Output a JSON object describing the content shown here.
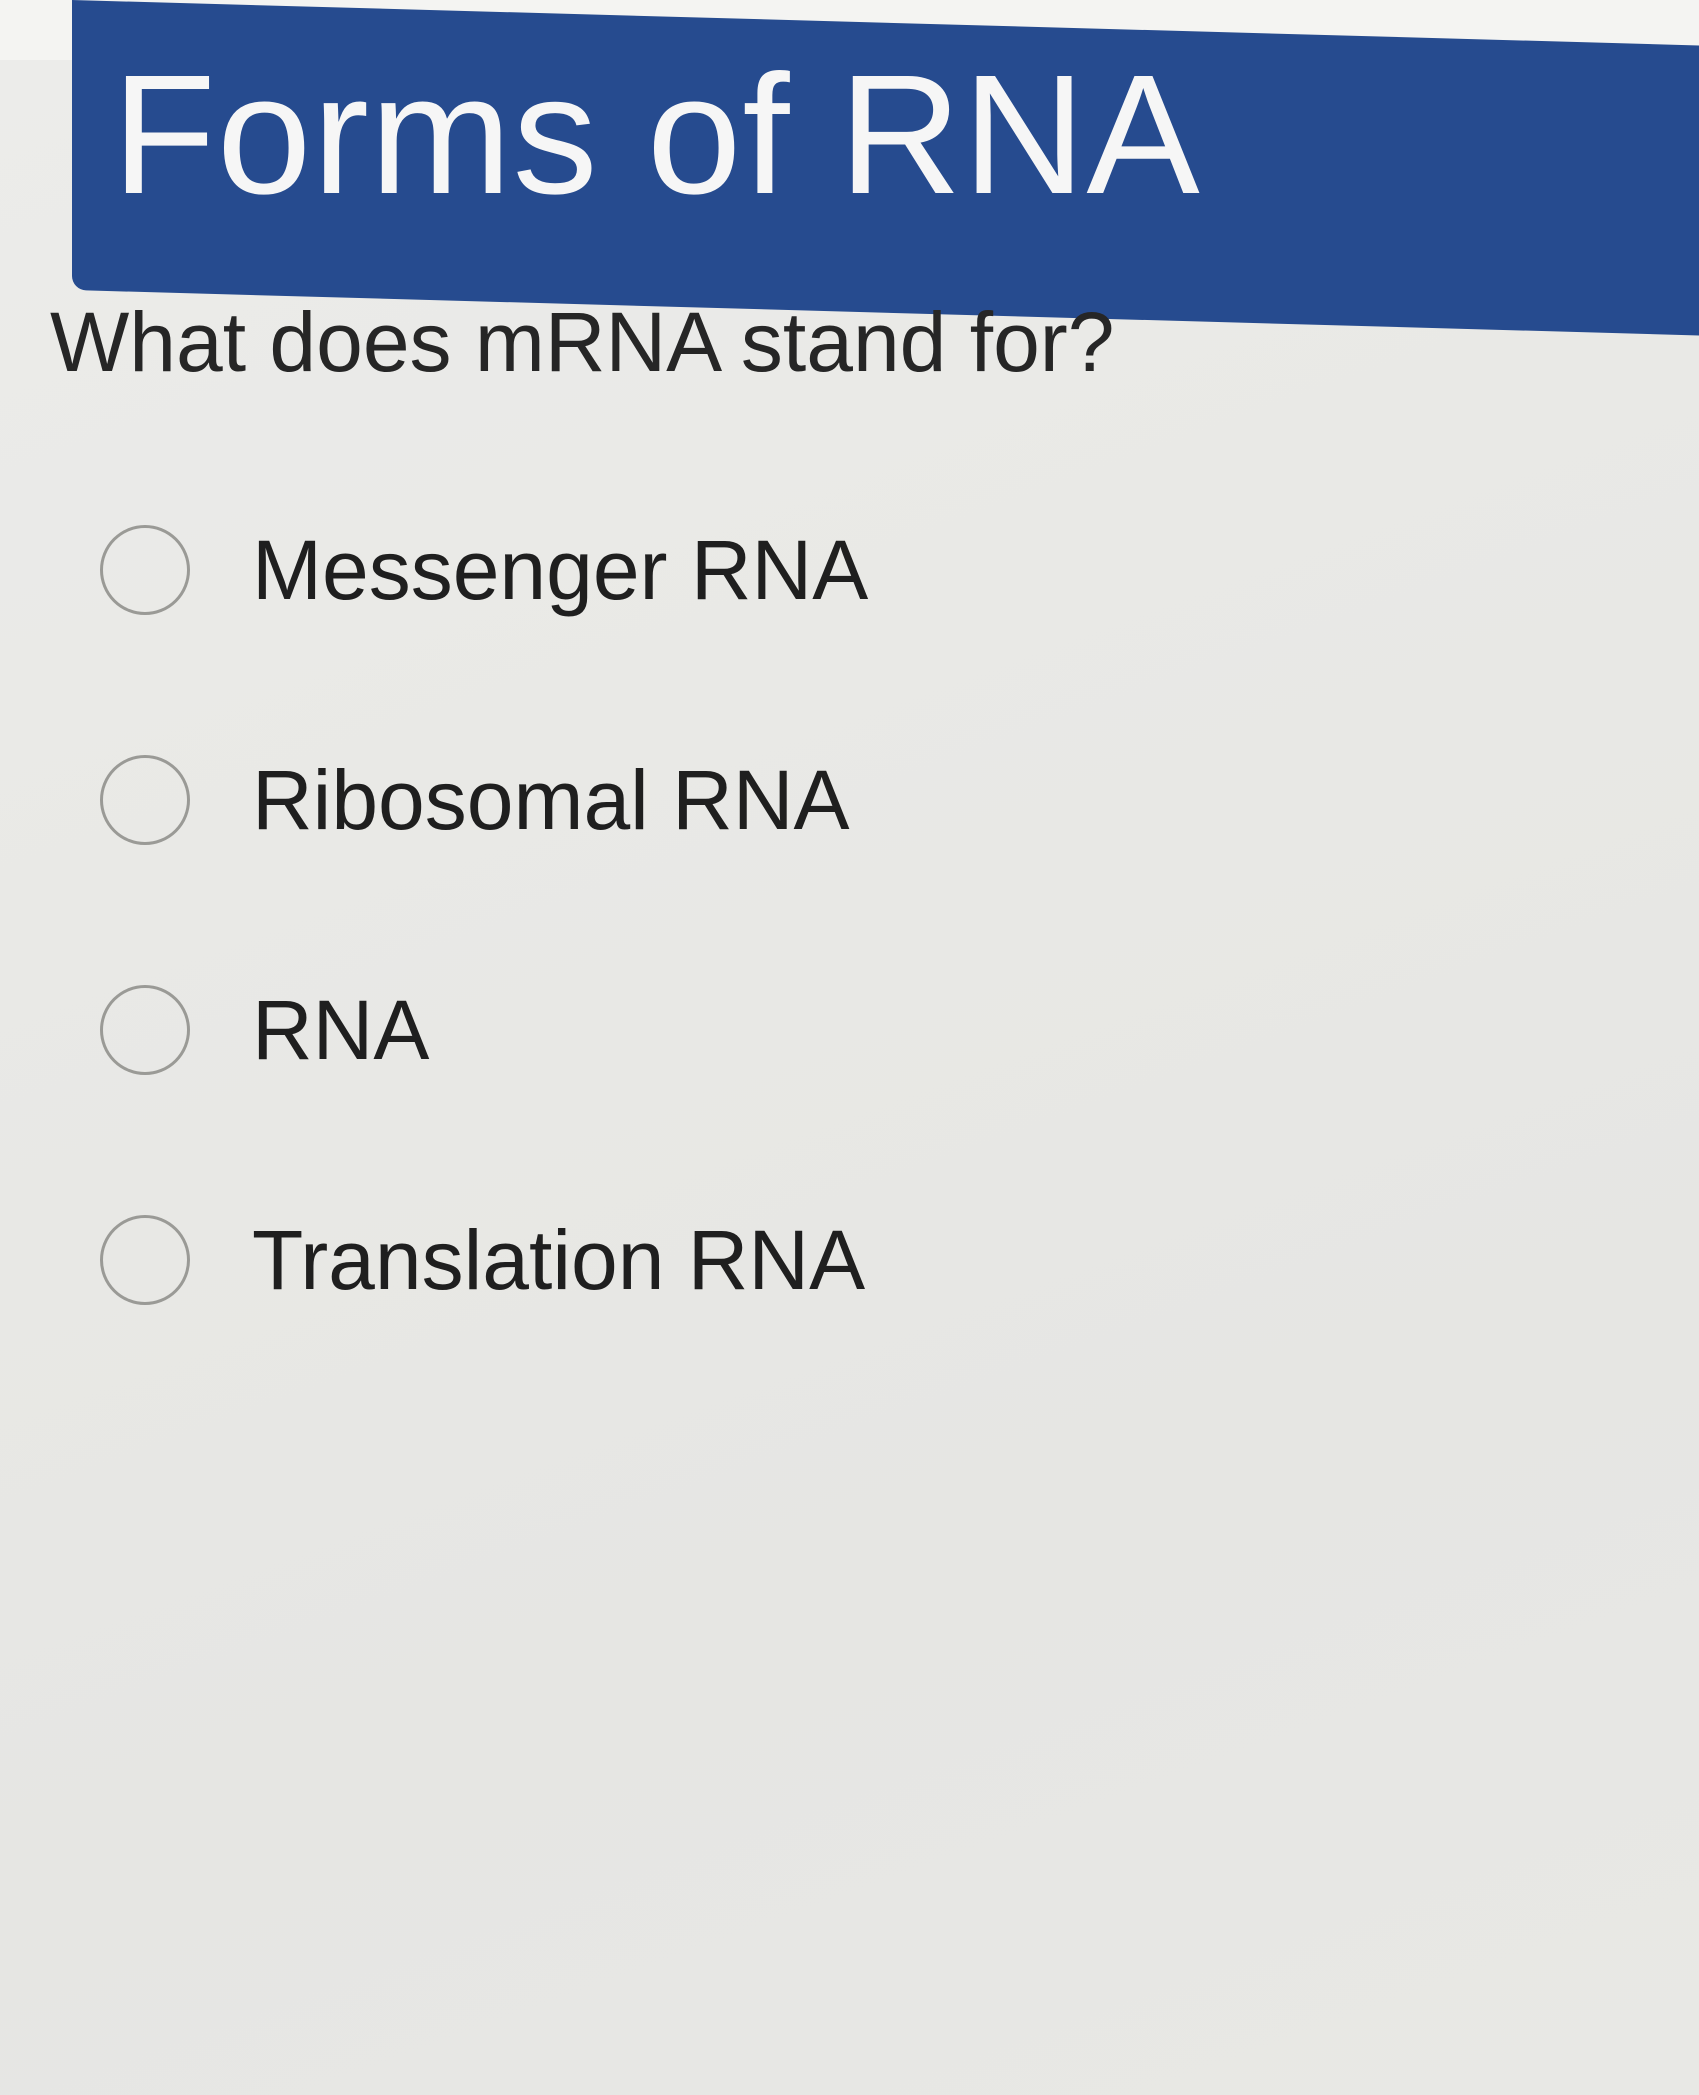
{
  "header": {
    "title": "Forms of RNA"
  },
  "question": {
    "text": "What does mRNA stand for?"
  },
  "options": [
    {
      "label": "Messenger RNA",
      "selected": false
    },
    {
      "label": "Ribosomal RNA",
      "selected": false
    },
    {
      "label": "RNA",
      "selected": false
    },
    {
      "label": "Translation RNA",
      "selected": false
    }
  ],
  "colors": {
    "banner": "#264b8f",
    "background": "#e9e9e6"
  }
}
